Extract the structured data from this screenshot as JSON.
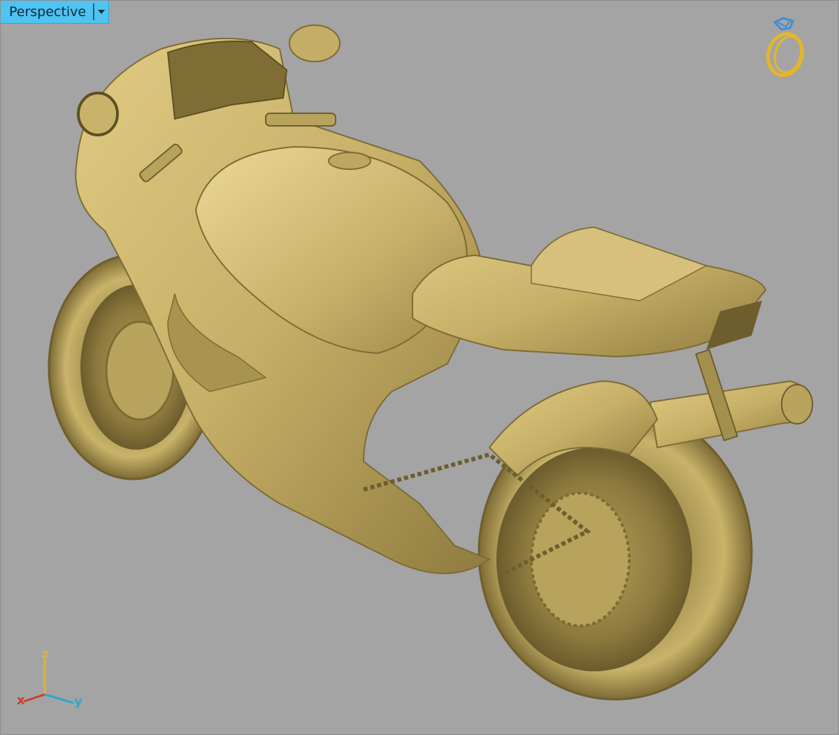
{
  "viewport": {
    "name": "Perspective",
    "dropdown_icon": "triangle-down-icon"
  },
  "overlay": {
    "ring_icon": "ring-icon"
  },
  "axes": {
    "z": "z",
    "x": "x",
    "y": "y"
  },
  "colors": {
    "background": "#a4a4a4",
    "tab": "#4fc3f2",
    "model": "#c9b36a",
    "axis_x": "#d23a2a",
    "axis_y": "#2aa9c9",
    "axis_z": "#e2b22e"
  }
}
